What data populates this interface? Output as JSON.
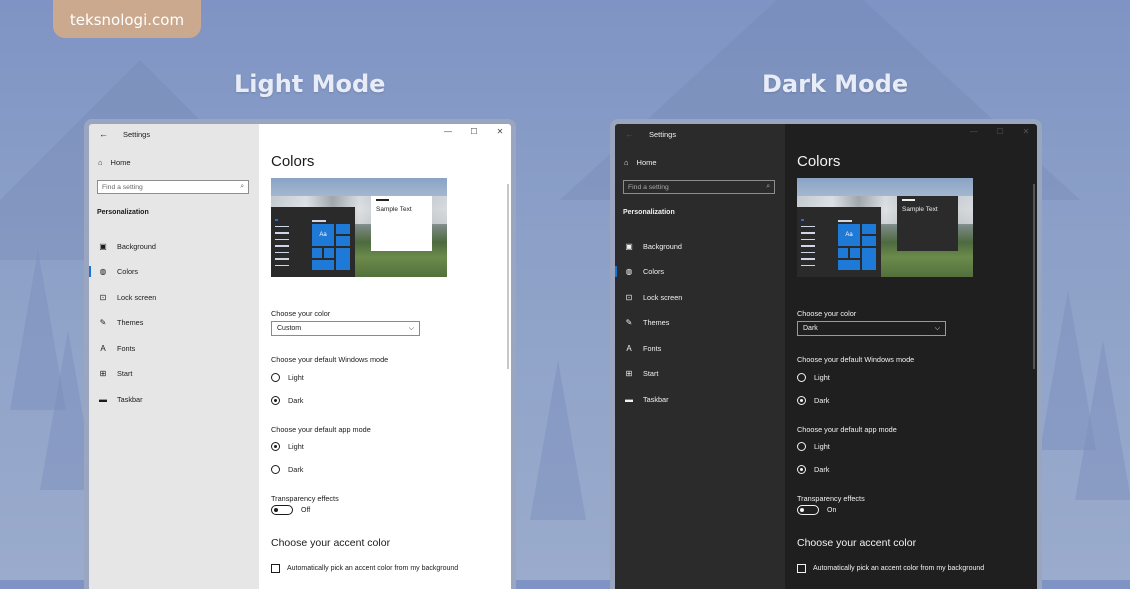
{
  "brand": "teksnologi.com",
  "panels": [
    {
      "heading": "Light Mode",
      "window_title": "Settings",
      "home": "Home",
      "search_placeholder": "Find a setting",
      "section": "Personalization",
      "nav": [
        "Background",
        "Colors",
        "Lock screen",
        "Themes",
        "Fonts",
        "Start",
        "Taskbar"
      ],
      "page_title": "Colors",
      "preview_tile_text": "Aa",
      "preview_sample_text": "Sample Text",
      "choose_color_label": "Choose your color",
      "choose_color_value": "Custom",
      "windows_mode_label": "Choose your default Windows mode",
      "windows_mode_options": [
        "Light",
        "Dark"
      ],
      "windows_mode_selected": "Dark",
      "app_mode_label": "Choose your default app mode",
      "app_mode_options": [
        "Light",
        "Dark"
      ],
      "app_mode_selected": "Light",
      "transparency_label": "Transparency effects",
      "transparency_value": "Off",
      "accent_heading": "Choose your accent color",
      "auto_accent_label": "Automatically pick an accent color from my background"
    },
    {
      "heading": "Dark Mode",
      "window_title": "Settings",
      "home": "Home",
      "search_placeholder": "Find a setting",
      "section": "Personalization",
      "nav": [
        "Background",
        "Colors",
        "Lock screen",
        "Themes",
        "Fonts",
        "Start",
        "Taskbar"
      ],
      "page_title": "Colors",
      "preview_tile_text": "Aa",
      "preview_sample_text": "Sample Text",
      "choose_color_label": "Choose your color",
      "choose_color_value": "Dark",
      "windows_mode_label": "Choose your default Windows mode",
      "windows_mode_options": [
        "Light",
        "Dark"
      ],
      "windows_mode_selected": "Dark",
      "app_mode_label": "Choose your default app mode",
      "app_mode_options": [
        "Light",
        "Dark"
      ],
      "app_mode_selected": "Dark",
      "transparency_label": "Transparency effects",
      "transparency_value": "On",
      "accent_heading": "Choose your accent color",
      "auto_accent_label": "Automatically pick an accent color from my background"
    }
  ],
  "icons": {
    "back": "back-arrow-icon",
    "home": "home-icon",
    "search": "search-icon",
    "nav": [
      "picture-icon",
      "palette-icon",
      "lock-screen-icon",
      "themes-icon",
      "fonts-icon",
      "start-icon",
      "taskbar-icon"
    ]
  },
  "colors": {
    "accent": "#1a73d2",
    "light_sidebar": "#e6e6e6",
    "dark_sidebar": "#2b2b2b",
    "dark_content": "#1f1f1f"
  }
}
